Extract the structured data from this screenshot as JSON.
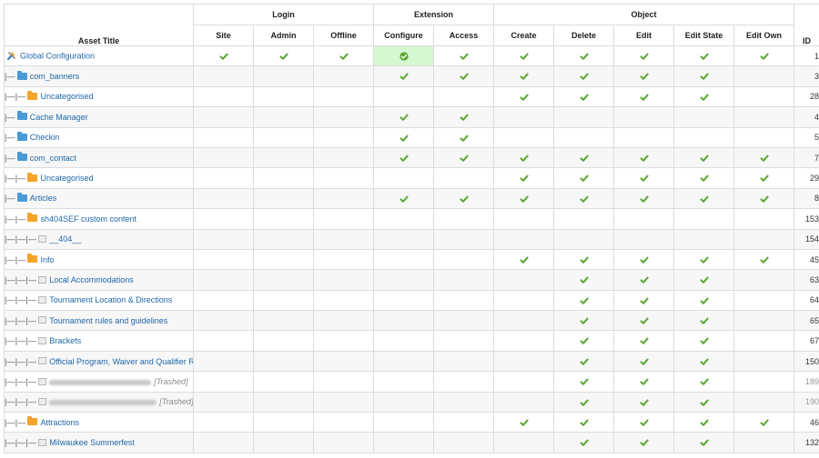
{
  "colors": {
    "check": "#5aa832",
    "link": "#1f67a8",
    "highlight": "#d6f7d1",
    "row_alt": "#f7f7f7",
    "folder_blue": "#4a9ad8",
    "folder_orange": "#f3a42a"
  },
  "headers": {
    "asset_title": "Asset Title",
    "id": "ID",
    "groups": [
      {
        "label": "Login",
        "columns": [
          "Site",
          "Admin",
          "Offline"
        ]
      },
      {
        "label": "Extension",
        "columns": [
          "Configure",
          "Access"
        ]
      },
      {
        "label": "Object",
        "columns": [
          "Create",
          "Delete",
          "Edit",
          "Edit State",
          "Edit Own"
        ]
      }
    ]
  },
  "columns": [
    "site",
    "admin",
    "offline",
    "configure",
    "access",
    "create",
    "delete",
    "edit",
    "edit_state",
    "edit_own"
  ],
  "rows": [
    {
      "prefix": "",
      "icon": "tools-icon",
      "title": "Global Configuration",
      "trashed": "",
      "blurred": false,
      "id": "1",
      "checks": [
        1,
        1,
        1,
        1,
        1,
        1,
        1,
        1,
        1,
        1
      ],
      "highlight": "configure"
    },
    {
      "prefix": "|—",
      "icon": "blue-folder-icon",
      "title": "com_banners",
      "trashed": "",
      "blurred": false,
      "id": "3",
      "checks": [
        0,
        0,
        0,
        1,
        1,
        1,
        1,
        1,
        1,
        0
      ]
    },
    {
      "prefix": "|—|—",
      "icon": "orange-folder-icon",
      "title": "Uncategorised",
      "trashed": "",
      "blurred": false,
      "id": "28",
      "checks": [
        0,
        0,
        0,
        0,
        0,
        1,
        1,
        1,
        1,
        0
      ]
    },
    {
      "prefix": "|—",
      "icon": "blue-folder-icon",
      "title": "Cache Manager",
      "trashed": "",
      "blurred": false,
      "id": "4",
      "checks": [
        0,
        0,
        0,
        1,
        1,
        0,
        0,
        0,
        0,
        0
      ]
    },
    {
      "prefix": "|—",
      "icon": "blue-folder-icon",
      "title": "Checkin",
      "trashed": "",
      "blurred": false,
      "id": "5",
      "checks": [
        0,
        0,
        0,
        1,
        1,
        0,
        0,
        0,
        0,
        0
      ]
    },
    {
      "prefix": "|—",
      "icon": "blue-folder-icon",
      "title": "com_contact",
      "trashed": "",
      "blurred": false,
      "id": "7",
      "checks": [
        0,
        0,
        0,
        1,
        1,
        1,
        1,
        1,
        1,
        1
      ]
    },
    {
      "prefix": "|—|—",
      "icon": "orange-folder-icon",
      "title": "Uncategorised",
      "trashed": "",
      "blurred": false,
      "id": "29",
      "checks": [
        0,
        0,
        0,
        0,
        0,
        1,
        1,
        1,
        1,
        1
      ]
    },
    {
      "prefix": "|—",
      "icon": "blue-folder-icon",
      "title": "Articles",
      "trashed": "",
      "blurred": false,
      "id": "8",
      "checks": [
        0,
        0,
        0,
        1,
        1,
        1,
        1,
        1,
        1,
        1
      ]
    },
    {
      "prefix": "|—|—",
      "icon": "orange-folder-icon",
      "title": "sh404SEF custom content",
      "trashed": "",
      "blurred": false,
      "id": "153",
      "checks": [
        0,
        0,
        0,
        0,
        0,
        0,
        0,
        0,
        0,
        0
      ]
    },
    {
      "prefix": "|—|—|—",
      "icon": "document-icon",
      "title": "__404__",
      "trashed": "",
      "blurred": false,
      "id": "154",
      "checks": [
        0,
        0,
        0,
        0,
        0,
        0,
        0,
        0,
        0,
        0
      ]
    },
    {
      "prefix": "|—|—",
      "icon": "orange-folder-icon",
      "title": "Info",
      "trashed": "",
      "blurred": false,
      "id": "45",
      "checks": [
        0,
        0,
        0,
        0,
        0,
        1,
        1,
        1,
        1,
        1
      ]
    },
    {
      "prefix": "|—|—|—",
      "icon": "document-icon",
      "title": "Local Accommodations",
      "trashed": "",
      "blurred": false,
      "id": "63",
      "checks": [
        0,
        0,
        0,
        0,
        0,
        0,
        1,
        1,
        1,
        0
      ]
    },
    {
      "prefix": "|—|—|—",
      "icon": "document-icon",
      "title": "Tournament Location & Directions",
      "trashed": "",
      "blurred": false,
      "id": "64",
      "checks": [
        0,
        0,
        0,
        0,
        0,
        0,
        1,
        1,
        1,
        0
      ]
    },
    {
      "prefix": "|—|—|—",
      "icon": "document-icon",
      "title": "Tournament rules and guidelines",
      "trashed": "",
      "blurred": false,
      "id": "65",
      "checks": [
        0,
        0,
        0,
        0,
        0,
        0,
        1,
        1,
        1,
        0
      ]
    },
    {
      "prefix": "|—|—|—",
      "icon": "document-icon",
      "title": "Brackets",
      "trashed": "",
      "blurred": false,
      "id": "67",
      "checks": [
        0,
        0,
        0,
        0,
        0,
        0,
        1,
        1,
        1,
        0
      ]
    },
    {
      "prefix": "|—|—|—",
      "icon": "document-icon",
      "title": "Official Program, Waiver and Qualifier Rules",
      "trashed": "",
      "blurred": false,
      "id": "150",
      "checks": [
        0,
        0,
        0,
        0,
        0,
        0,
        1,
        1,
        1,
        0
      ]
    },
    {
      "prefix": "|—|—|—",
      "icon": "document-icon",
      "title": "",
      "trashed": "[Trashed]",
      "blurred": true,
      "id": "189",
      "checks": [
        0,
        0,
        0,
        0,
        0,
        0,
        1,
        1,
        1,
        0
      ]
    },
    {
      "prefix": "|—|—|—",
      "icon": "document-icon",
      "title": "",
      "trashed": "[Trashed]",
      "blurred": true,
      "id": "190",
      "checks": [
        0,
        0,
        0,
        0,
        0,
        0,
        1,
        1,
        1,
        0
      ]
    },
    {
      "prefix": "|—|—",
      "icon": "orange-folder-icon",
      "title": "Attractions",
      "trashed": "",
      "blurred": false,
      "id": "46",
      "checks": [
        0,
        0,
        0,
        0,
        0,
        1,
        1,
        1,
        1,
        1
      ]
    },
    {
      "prefix": "|—|—|—",
      "icon": "document-icon",
      "title": "Milwaukee Summerfest",
      "trashed": "",
      "blurred": false,
      "id": "132",
      "checks": [
        0,
        0,
        0,
        0,
        0,
        0,
        1,
        1,
        1,
        0
      ]
    }
  ]
}
